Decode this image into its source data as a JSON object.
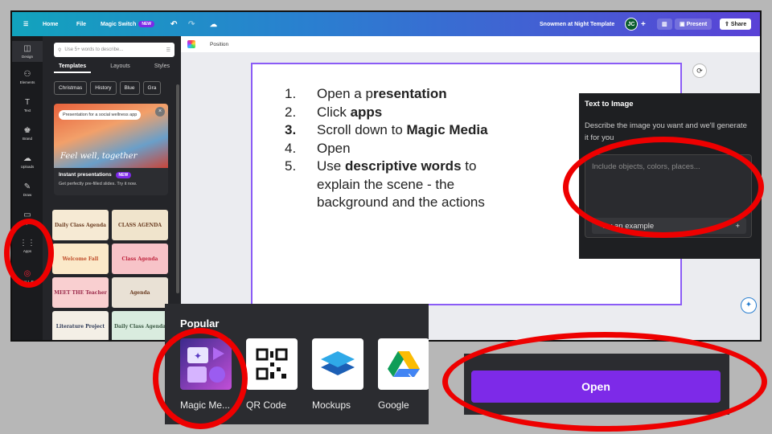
{
  "topbar": {
    "home": "Home",
    "file": "File",
    "magic_switch": "Magic Switch",
    "new_badge": "NEW",
    "doc_title": "Snowmen at Night Template",
    "avatar_initials": "JC",
    "present": "Present",
    "share": "Share"
  },
  "rail": [
    {
      "label": "Design",
      "icon": "layout-icon",
      "glyph": "◫"
    },
    {
      "label": "Elements",
      "icon": "shapes-icon",
      "glyph": "⚇"
    },
    {
      "label": "Text",
      "icon": "text-icon",
      "glyph": "T"
    },
    {
      "label": "Brand",
      "icon": "brand-icon",
      "glyph": "♚"
    },
    {
      "label": "Uploads",
      "icon": "upload-icon",
      "glyph": "☁"
    },
    {
      "label": "Draw",
      "icon": "draw-icon",
      "glyph": "✎"
    },
    {
      "label": "Projects",
      "icon": "folder-icon",
      "glyph": "▭"
    },
    {
      "label": "Apps",
      "icon": "apps-icon",
      "glyph": "⋮⋮"
    },
    {
      "label": "DALL·E",
      "icon": "dalle-icon",
      "glyph": "◎"
    }
  ],
  "panel": {
    "search_placeholder": "Use 5+ words to describe...",
    "tabs": [
      "Templates",
      "Layouts",
      "Styles"
    ],
    "chips": [
      "Christmas",
      "History",
      "Blue",
      "Gra"
    ],
    "promo_pill": "Presentation for a social wellness app",
    "promo_image_text": "Feel well, together",
    "promo_title": "Instant presentations",
    "promo_badge": "NEW",
    "promo_sub": "Get perfectly pre-filled slides. Try it now.",
    "thumbs": [
      "Daily Class Agenda",
      "CLASS AGENDA",
      "Welcome Fall",
      "Class Agenda",
      "MEET THE Teacher",
      "Agenda",
      "Literature Project",
      "Daily Class Agenda"
    ]
  },
  "canvas": {
    "position_label": "Position",
    "steps": [
      {
        "num": "1.",
        "pre": "Open a p",
        "bold": "resentation",
        "post": ""
      },
      {
        "num": "2.",
        "pre": "Click ",
        "bold": "apps",
        "post": ""
      },
      {
        "num": "3.",
        "pre": "Scroll down to ",
        "bold": "Magic Media",
        "post": ""
      },
      {
        "num": "4.",
        "pre": "Open",
        "bold": "",
        "post": ""
      },
      {
        "num": "5.",
        "pre": "Use ",
        "bold": "descriptive words",
        "post": " to explain the scene - the background and the actions"
      }
    ]
  },
  "text_to_image": {
    "title": "Text to Image",
    "desc": "Describe the image you want and we'll generate it for you",
    "placeholder": "Include objects, colors, places...",
    "example": "Try an example"
  },
  "popular": {
    "heading": "Popular",
    "apps": [
      {
        "label": "Magic Me...",
        "icon": "magic-media-icon"
      },
      {
        "label": "QR Code",
        "icon": "qr-code-icon"
      },
      {
        "label": "Mockups",
        "icon": "mockups-icon"
      },
      {
        "label": "Google",
        "icon": "google-drive-icon"
      }
    ]
  },
  "open_button": "Open",
  "colors": {
    "accent": "#7d2ae8",
    "highlight": "#ee0000"
  }
}
